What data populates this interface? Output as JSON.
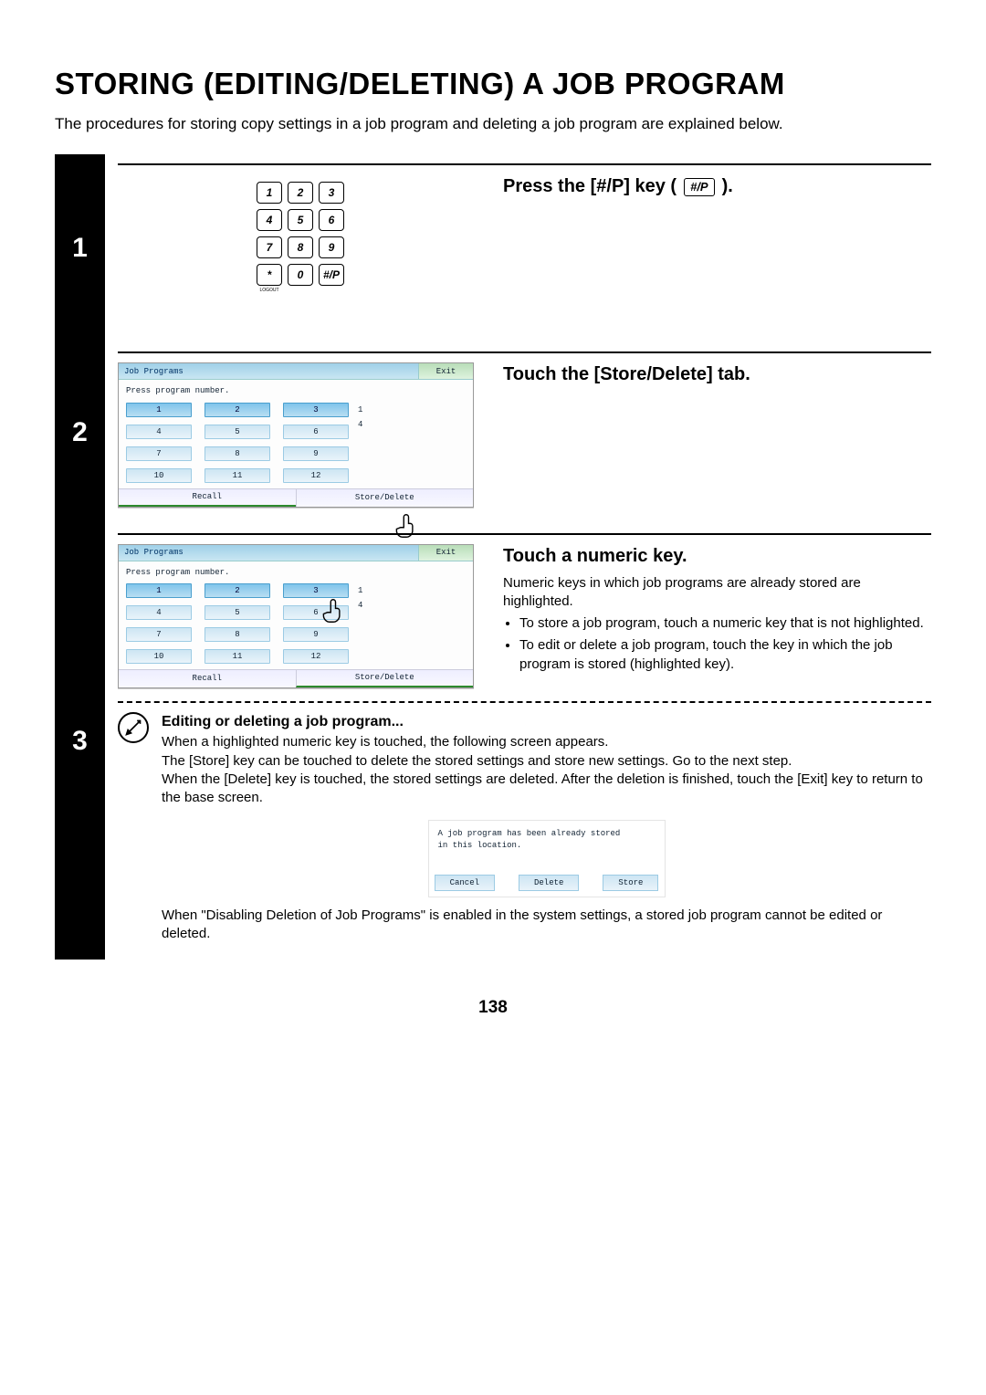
{
  "title": "STORING (EDITING/DELETING) A JOB PROGRAM",
  "intro": "The procedures for storing copy settings in a job program and deleting a job program are explained below.",
  "page_number": "138",
  "step1": {
    "number": "1",
    "heading_prefix": "Press the [#/P] key (",
    "heading_suffix": ").",
    "key_label": "#/P",
    "keypad": [
      "1",
      "2",
      "3",
      "4",
      "5",
      "6",
      "7",
      "8",
      "9",
      "*",
      "0",
      "#/P"
    ],
    "logout": "LOGOUT"
  },
  "step2": {
    "number": "2",
    "heading": "Touch the [Store/Delete] tab.",
    "panel": {
      "title": "Job Programs",
      "exit": "Exit",
      "sub": "Press program number.",
      "buttons": [
        "1",
        "2",
        "3",
        "4",
        "5",
        "6",
        "7",
        "8",
        "9",
        "10",
        "11",
        "12"
      ],
      "pages": [
        "1",
        "4"
      ],
      "tab_recall": "Recall",
      "tab_store": "Store/Delete"
    }
  },
  "step3": {
    "number": "3",
    "heading": "Touch a numeric key.",
    "sub": "Numeric keys in which job programs are already stored are highlighted.",
    "bullet1": "To store a job program, touch a numeric key that is not highlighted.",
    "bullet2": "To edit or delete a job program, touch the key in which the job program is stored (highlighted key).",
    "panel": {
      "title": "Job Programs",
      "exit": "Exit",
      "sub": "Press program number.",
      "buttons": [
        "1",
        "2",
        "3",
        "4",
        "5",
        "6",
        "7",
        "8",
        "9",
        "10",
        "11",
        "12"
      ],
      "pages": [
        "1",
        "4"
      ],
      "tab_recall": "Recall",
      "tab_store": "Store/Delete"
    },
    "note_head": "Editing or deleting a job program...",
    "note1": "When a highlighted numeric key is touched, the following screen appears.",
    "note2": "The [Store] key can be touched to delete the stored settings and store new settings. Go to the next step.",
    "note3": "When the [Delete] key is touched, the stored settings are deleted. After the deletion is finished, touch the [Exit] key to return to the base screen.",
    "dialog_l1": "A job program has been already stored",
    "dialog_l2": "in this location.",
    "cancel": "Cancel",
    "delete": "Delete",
    "store": "Store",
    "closing": "When \"Disabling Deletion of Job Programs\" is enabled in the system settings, a stored job program cannot be edited or deleted."
  }
}
